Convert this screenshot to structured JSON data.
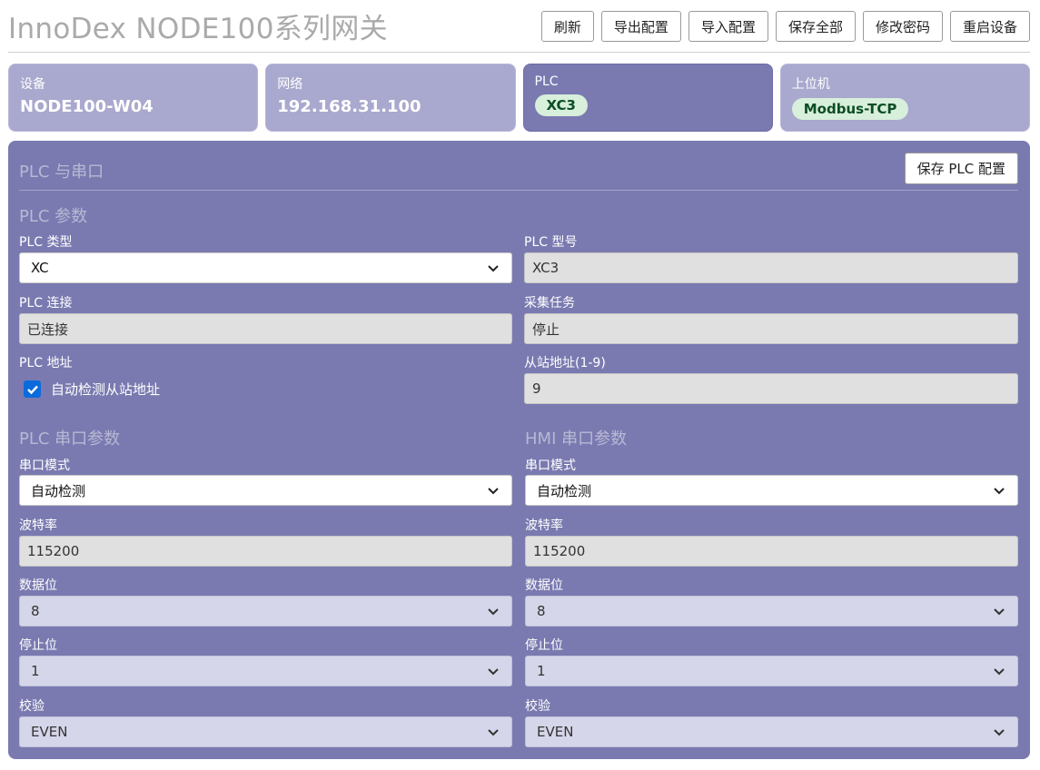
{
  "app": {
    "title": "InnoDex NODE100系列网关"
  },
  "toolbar": {
    "refresh": "刷新",
    "export_config": "导出配置",
    "import_config": "导入配置",
    "save_all": "保存全部",
    "change_password": "修改密码",
    "restart_device": "重启设备"
  },
  "cards": {
    "device": {
      "label": "设备",
      "value": "NODE100-W04"
    },
    "network": {
      "label": "网络",
      "value": "192.168.31.100"
    },
    "plc": {
      "label": "PLC",
      "value": "XC3"
    },
    "host": {
      "label": "上位机",
      "value": "Modbus-TCP"
    }
  },
  "panel": {
    "title": "PLC 与串口",
    "save_button": "保存 PLC 配置",
    "plc_params": {
      "title": "PLC 参数",
      "plc_type": {
        "label": "PLC 类型",
        "value": "XC"
      },
      "plc_model": {
        "label": "PLC 型号",
        "value": "XC3"
      },
      "plc_connection": {
        "label": "PLC 连接",
        "value": "已连接"
      },
      "collect_task": {
        "label": "采集任务",
        "value": "停止"
      },
      "plc_address": {
        "label": "PLC 地址",
        "auto_detect_label": "自动检测从站地址",
        "auto_detect_checked": true
      },
      "slave_address": {
        "label": "从站地址(1-9)",
        "value": "9"
      }
    },
    "plc_serial": {
      "title": "PLC 串口参数",
      "mode": {
        "label": "串口模式",
        "value": "自动检测"
      },
      "baud": {
        "label": "波特率",
        "value": "115200"
      },
      "data_bits": {
        "label": "数据位",
        "value": "8"
      },
      "stop_bits": {
        "label": "停止位",
        "value": "1"
      },
      "parity": {
        "label": "校验",
        "value": "EVEN"
      }
    },
    "hmi_serial": {
      "title": "HMI 串口参数",
      "mode": {
        "label": "串口模式",
        "value": "自动检测"
      },
      "baud": {
        "label": "波特率",
        "value": "115200"
      },
      "data_bits": {
        "label": "数据位",
        "value": "8"
      },
      "stop_bits": {
        "label": "停止位",
        "value": "1"
      },
      "parity": {
        "label": "校验",
        "value": "EVEN"
      }
    }
  },
  "colors": {
    "panel_bg": "#7a7ab1",
    "card_bg": "#a9a8ce",
    "pill_bg": "#d7efdb",
    "pill_text": "#0d4d24",
    "checkbox": "#0b6bdc"
  },
  "icons": {
    "select_arrow": "chevron-down-icon",
    "checkbox": "checkmark-icon"
  }
}
